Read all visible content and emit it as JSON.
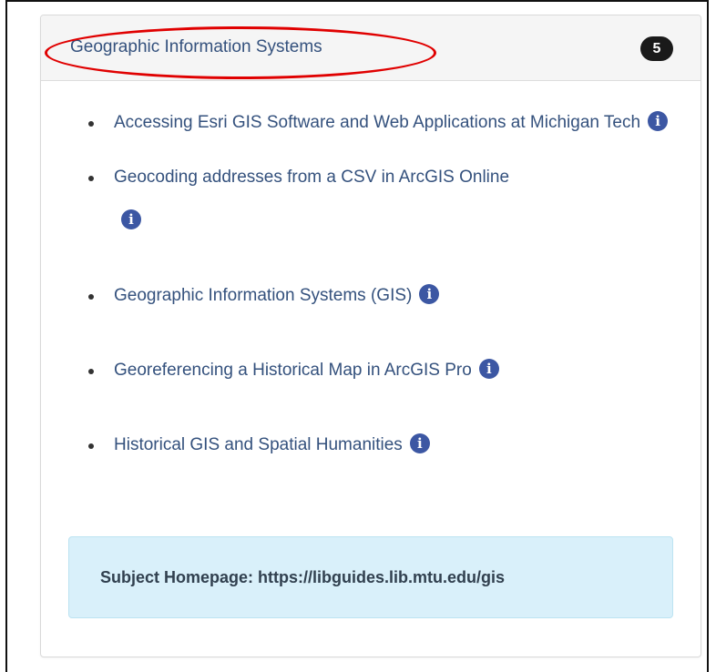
{
  "panel": {
    "title": "Geographic Information Systems",
    "count": "5"
  },
  "guides": [
    {
      "title": "Accessing Esri GIS Software and Web Applications at Michigan Tech",
      "info_icon": "info-circle-icon"
    },
    {
      "title": "Geocoding addresses from a CSV in ArcGIS Online",
      "info_icon": "info-circle-icon"
    },
    {
      "title": "Geographic Information Systems (GIS)",
      "info_icon": "info-circle-icon"
    },
    {
      "title": "Georeferencing a Historical Map in ArcGIS Pro",
      "info_icon": "info-circle-icon"
    },
    {
      "title": "Historical GIS and Spatial Humanities",
      "info_icon": "info-circle-icon"
    }
  ],
  "info_glyph": "i",
  "subject_homepage": {
    "label": "Subject Homepage:",
    "url": "https://libguides.lib.mtu.edu/gis"
  },
  "colors": {
    "link": "#34517d",
    "annotation_ellipse": "#e00000",
    "badge": "#1a1a1a",
    "info_icon": "#3c57a3",
    "homepage_box": "#d9f0fa"
  }
}
